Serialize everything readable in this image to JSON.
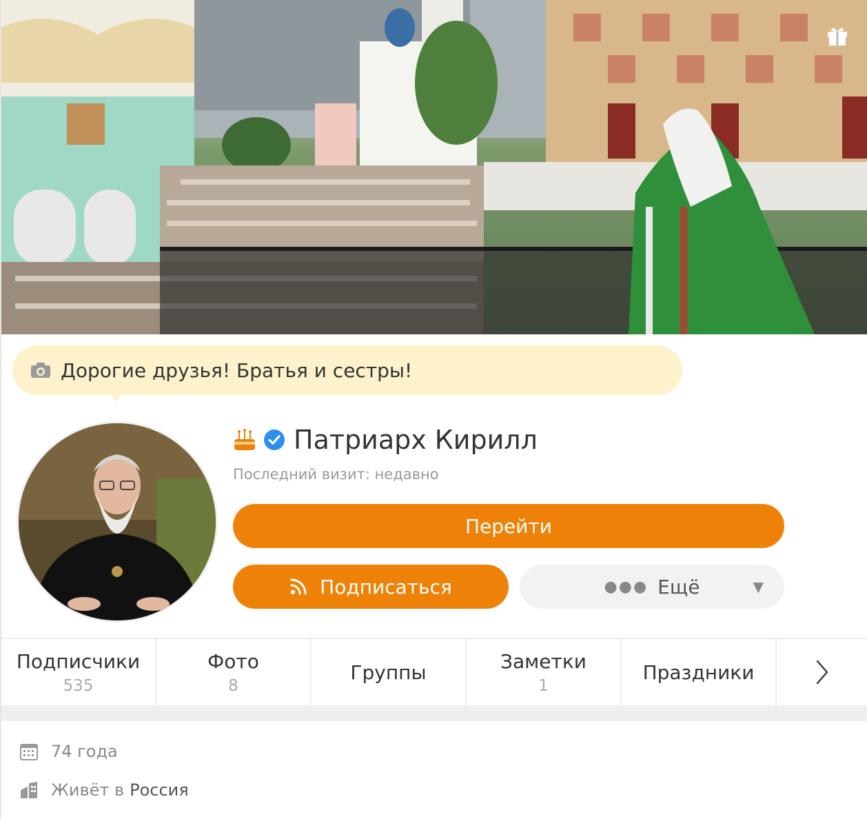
{
  "status": {
    "text": "Дорогие друзья! Братья и сестры!"
  },
  "profile": {
    "name": "Патриарх Кирилл",
    "last_visit": "Последний визит: недавно"
  },
  "buttons": {
    "go": "Перейти",
    "subscribe": "Подписаться",
    "more": "Ещё"
  },
  "tabs": [
    {
      "label": "Подписчики",
      "count": "535"
    },
    {
      "label": "Фото",
      "count": "8"
    },
    {
      "label": "Группы",
      "count": ""
    },
    {
      "label": "Заметки",
      "count": "1"
    },
    {
      "label": "Праздники",
      "count": ""
    }
  ],
  "info": {
    "age": "74 года",
    "lives_prefix": "Живёт в",
    "country": "Россия"
  },
  "colors": {
    "accent": "#ee8208",
    "status_bg": "#fdf2cc",
    "verified": "#2d8ef0"
  },
  "icons": [
    "gift-icon",
    "camera-icon",
    "cake-icon",
    "verified-icon",
    "rss-icon",
    "dots-icon",
    "chevron-down-icon",
    "chevron-right-icon",
    "calendar-icon",
    "building-icon"
  ]
}
